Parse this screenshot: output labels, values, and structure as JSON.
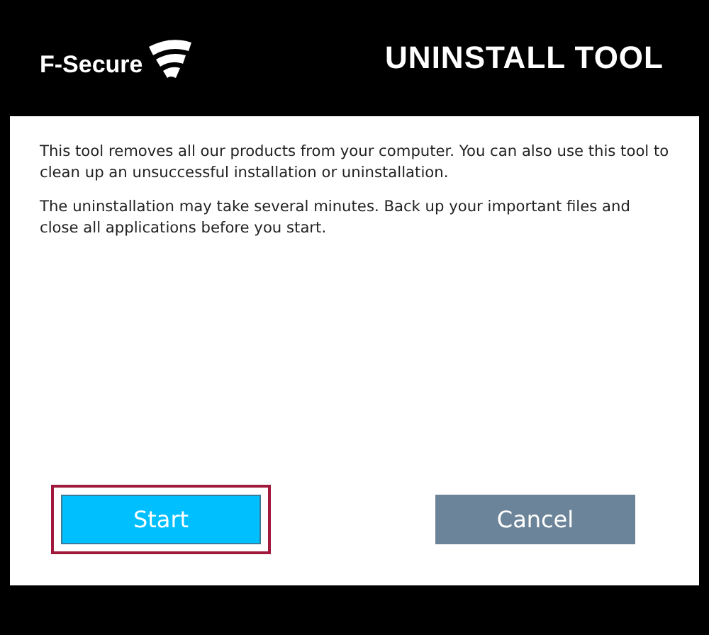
{
  "header": {
    "logo_text": "F-Secure",
    "title": "UNINSTALL TOOL"
  },
  "paragraphs": [
    "This tool removes all our products from your computer. You can also use this tool to clean up an unsuccessful installation or uninstallation.",
    "The uninstallation may take several minutes. Back up your important files and close all applications before you start."
  ],
  "buttons": [
    {
      "label": "Start",
      "kind": "primary",
      "focused": true
    },
    {
      "label": "Cancel",
      "kind": "secondary",
      "focused": false
    }
  ]
}
